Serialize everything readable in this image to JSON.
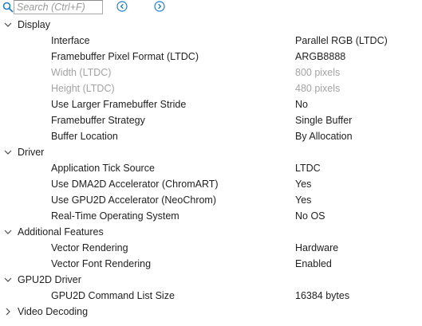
{
  "search": {
    "placeholder": "Search (Ctrl+F)"
  },
  "colors": {
    "accent": "#1e7fd0",
    "text": "#1f1f1f",
    "disabled": "#a3a3a3",
    "border": "#a9a9a9"
  },
  "icons": {
    "search": "search-icon",
    "prev": "circle-chevron-left-icon",
    "next": "circle-chevron-right-icon",
    "expanded": "chevron-down-icon",
    "collapsed": "chevron-right-icon"
  },
  "tree": {
    "display": {
      "label": "Display",
      "items": [
        {
          "label": "Interface",
          "value": "Parallel RGB (LTDC)"
        },
        {
          "label": "Framebuffer Pixel Format (LTDC)",
          "value": "ARGB8888"
        },
        {
          "label": "Width (LTDC)",
          "value": "800 pixels"
        },
        {
          "label": "Height (LTDC)",
          "value": "480 pixels"
        },
        {
          "label": "Use Larger Framebuffer Stride",
          "value": "No"
        },
        {
          "label": "Framebuffer Strategy",
          "value": "Single Buffer"
        },
        {
          "label": "Buffer Location",
          "value": "By Allocation"
        }
      ]
    },
    "driver": {
      "label": "Driver",
      "items": [
        {
          "label": "Application Tick Source",
          "value": "LTDC"
        },
        {
          "label": "Use DMA2D Accelerator (ChromART)",
          "value": "Yes"
        },
        {
          "label": "Use GPU2D Accelerator (NeoChrom)",
          "value": "Yes"
        },
        {
          "label": "Real-Time Operating System",
          "value": "No OS"
        }
      ]
    },
    "additional": {
      "label": "Additional Features",
      "items": [
        {
          "label": "Vector Rendering",
          "value": "Hardware"
        },
        {
          "label": "Vector Font Rendering",
          "value": "Enabled"
        }
      ]
    },
    "gpu2d": {
      "label": "GPU2D Driver",
      "items": [
        {
          "label": "GPU2D Command List Size",
          "value": "16384 bytes"
        }
      ]
    },
    "video": {
      "label": "Video Decoding"
    }
  }
}
